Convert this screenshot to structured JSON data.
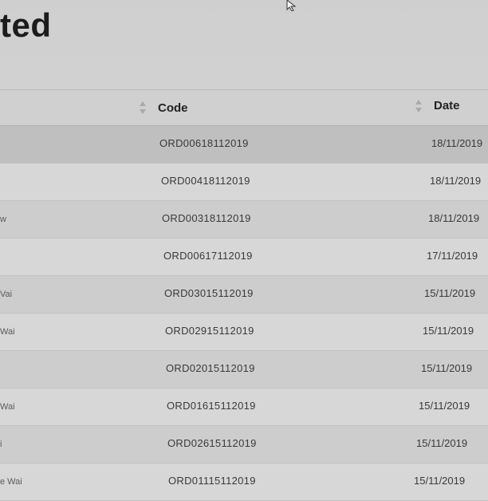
{
  "page": {
    "title": "ted"
  },
  "table": {
    "columns": [
      {
        "label": "Code"
      },
      {
        "label": "Date"
      }
    ],
    "rows": [
      {
        "name": "",
        "code": "ORD00618112019",
        "date": "18/11/2019"
      },
      {
        "name": "",
        "code": "ORD00418112019",
        "date": "18/11/2019"
      },
      {
        "name": "w",
        "code": "ORD00318112019",
        "date": "18/11/2019"
      },
      {
        "name": "",
        "code": "ORD00617112019",
        "date": "17/11/2019"
      },
      {
        "name": "Vai",
        "code": "ORD03015112019",
        "date": "15/11/2019"
      },
      {
        "name": "Wai",
        "code": "ORD02915112019",
        "date": "15/11/2019"
      },
      {
        "name": "",
        "code": "ORD02015112019",
        "date": "15/11/2019"
      },
      {
        "name": "Wai",
        "code": "ORD01615112019",
        "date": "15/11/2019"
      },
      {
        "name": "i",
        "code": "ORD02615112019",
        "date": "15/11/2019"
      },
      {
        "name": "e Wai",
        "code": "ORD01115112019",
        "date": "15/11/2019"
      }
    ]
  }
}
